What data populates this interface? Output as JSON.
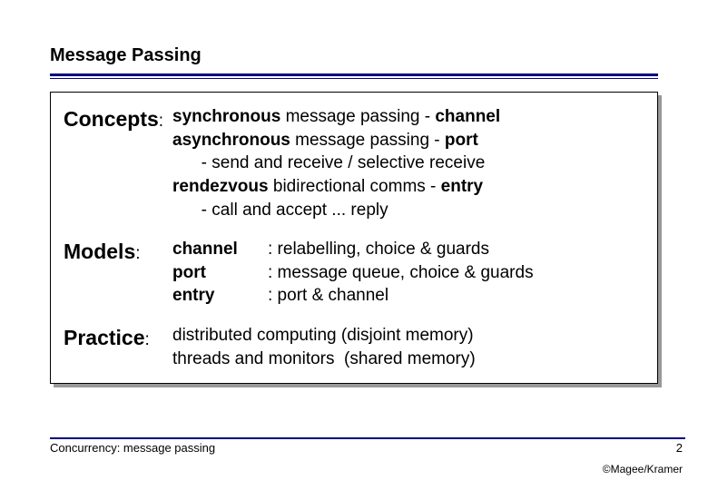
{
  "title": "Message Passing",
  "concepts": {
    "label": "Concepts",
    "l1a": "synchronous",
    "l1b": " message passing - ",
    "l1c": "channel",
    "l2a": "asynchronous",
    "l2b": " message passing - ",
    "l2c": "port",
    "l3a": "      - send and receive / selective receive",
    "l4a": "rendezvous",
    "l4b": " bidirectional comms - ",
    "l4c": "entry",
    "l5a": "      - call and accept ... reply"
  },
  "models": {
    "label": "Models",
    "r1a": "channel",
    "r1b": ": relabelling, choice & guards",
    "r2a": "port",
    "r2b": ": message queue, choice & guards",
    "r3a": "entry",
    "r3b": ": port & channel"
  },
  "practice": {
    "label": "Practice",
    "l1": "distributed computing (disjoint memory)",
    "l2": "threads and monitors  (shared memory)"
  },
  "footer": {
    "left": "Concurrency: message passing",
    "page": "2",
    "copy": "©Magee/Kramer"
  }
}
